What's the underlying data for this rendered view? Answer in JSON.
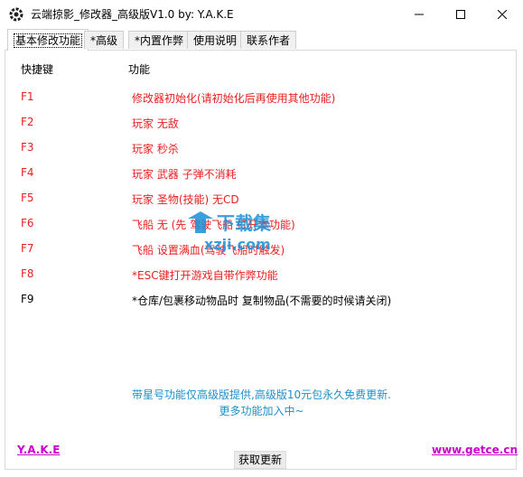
{
  "window": {
    "title": "云端掠影_修改器_高级版V1.0 by: Y.A.K.E",
    "icon": "gear-icon",
    "controls": [
      "minimize-icon",
      "maximize-icon",
      "close-icon"
    ]
  },
  "tabs": [
    {
      "label": "基本修改功能",
      "active": true
    },
    {
      "label": "*高级",
      "active": false
    },
    {
      "label": "*内置作弊",
      "active": false
    },
    {
      "label": "使用说明",
      "active": false
    },
    {
      "label": "联系作者",
      "active": false
    }
  ],
  "table": {
    "headers": {
      "key": "快捷键",
      "function": "功能"
    },
    "rows": [
      {
        "key": "F1",
        "function": "修改器初始化(请初始化后再使用其他功能)",
        "color": "red"
      },
      {
        "key": "F2",
        "function": "玩家 无敌",
        "color": "red"
      },
      {
        "key": "F3",
        "function": "玩家 秒杀",
        "color": "red"
      },
      {
        "key": "F4",
        "function": "玩家 武器 子弹不消耗",
        "color": "red"
      },
      {
        "key": "F5",
        "function": "玩家 圣物(技能) 无CD",
        "color": "red"
      },
      {
        "key": "F6",
        "function": "飞船 无 (先 驾驶飞船 打开本功能)",
        "color": "red"
      },
      {
        "key": "F7",
        "function": "飞船 设置满血(驾驶飞船时触发)",
        "color": "red"
      },
      {
        "key": "F8",
        "function": "*ESC键打开游戏自带作弊功能",
        "color": "red"
      },
      {
        "key": "F9",
        "function": "*仓库/包裹移动物品时 复制物品(不需要的时候请关闭)",
        "color": "black"
      }
    ]
  },
  "notes": {
    "line1": "带星号功能仅高级版提供,高级版10元包永久免费更新.",
    "line2": "更多功能加入中~"
  },
  "footer": {
    "left_link": "Y.A.K.E",
    "right_link": "www.getce.cn",
    "refresh_button": "获取更新"
  },
  "watermark": {
    "text": "下载集",
    "url": "xzji.com"
  },
  "colors": {
    "red": "#e81f1f",
    "note": "#1f8fc9",
    "link": "#cc00cc"
  }
}
